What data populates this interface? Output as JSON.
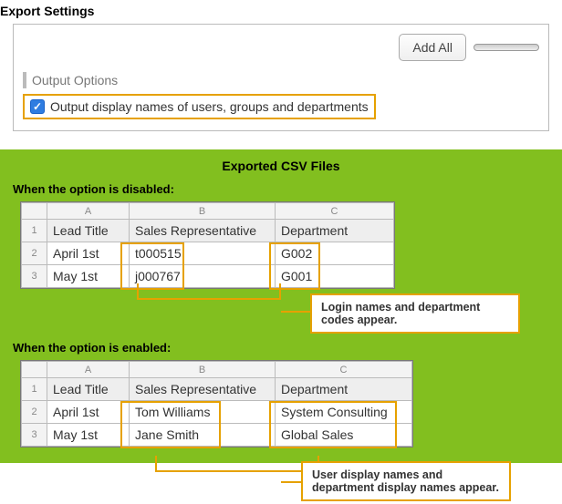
{
  "title": "Export Settings",
  "settings": {
    "add_all_label": "Add All",
    "section_label": "Output Options",
    "checkbox_checked": true,
    "checkbox_label": "Output display names of users, groups and departments"
  },
  "csv": {
    "title": "Exported CSV Files",
    "disabled_heading": "When the option is disabled:",
    "enabled_heading": "When the option is enabled:",
    "col_letters": [
      "A",
      "B",
      "C"
    ],
    "row_nums": [
      "1",
      "2",
      "3"
    ],
    "headers": {
      "a": "Lead Title",
      "b": "Sales Representative",
      "c": "Department"
    },
    "disabled_rows": [
      {
        "a": "April 1st",
        "b": "t000515",
        "c": "G002"
      },
      {
        "a": "May 1st",
        "b": "j000767",
        "c": "G001"
      }
    ],
    "enabled_rows": [
      {
        "a": "April 1st",
        "b": "Tom Williams",
        "c": "System Consulting"
      },
      {
        "a": "May 1st",
        "b": "Jane Smith",
        "c": "Global Sales"
      }
    ],
    "callout_disabled": "Login names and department codes appear.",
    "callout_enabled": "User display names and department display names appear."
  }
}
